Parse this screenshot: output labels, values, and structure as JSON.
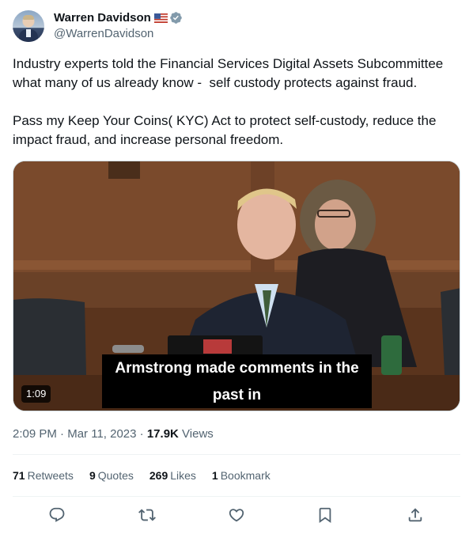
{
  "author": {
    "display_name": "Warren Davidson",
    "handle": "@WarrenDavidson",
    "flag_icon": "us-flag-icon",
    "verified_icon": "verified-badge-icon",
    "verified_color": "#829aab"
  },
  "tweet": {
    "text": "Industry experts told the Financial Services Digital Assets Subcommittee what many of us already know -  self custody protects against fraud.\n\nPass my Keep Your Coins( KYC) Act to protect self-custody, reduce the impact fraud, and increase personal freedom."
  },
  "media": {
    "caption_line1": "Armstrong made comments in the",
    "caption_line2": "past in",
    "duration": "1:09"
  },
  "meta": {
    "time": "2:09 PM",
    "separator": "·",
    "date": "Mar 11, 2023",
    "views_count": "17.9K",
    "views_label": "Views"
  },
  "stats": [
    {
      "count": "71",
      "label": "Retweets"
    },
    {
      "count": "9",
      "label": "Quotes"
    },
    {
      "count": "269",
      "label": "Likes"
    },
    {
      "count": "1",
      "label": "Bookmark"
    }
  ],
  "actions": [
    "reply-icon",
    "retweet-icon",
    "like-icon",
    "bookmark-icon",
    "share-icon"
  ],
  "colors": {
    "text": "#0f1419",
    "secondary": "#536471",
    "divider": "#eff3f4"
  }
}
